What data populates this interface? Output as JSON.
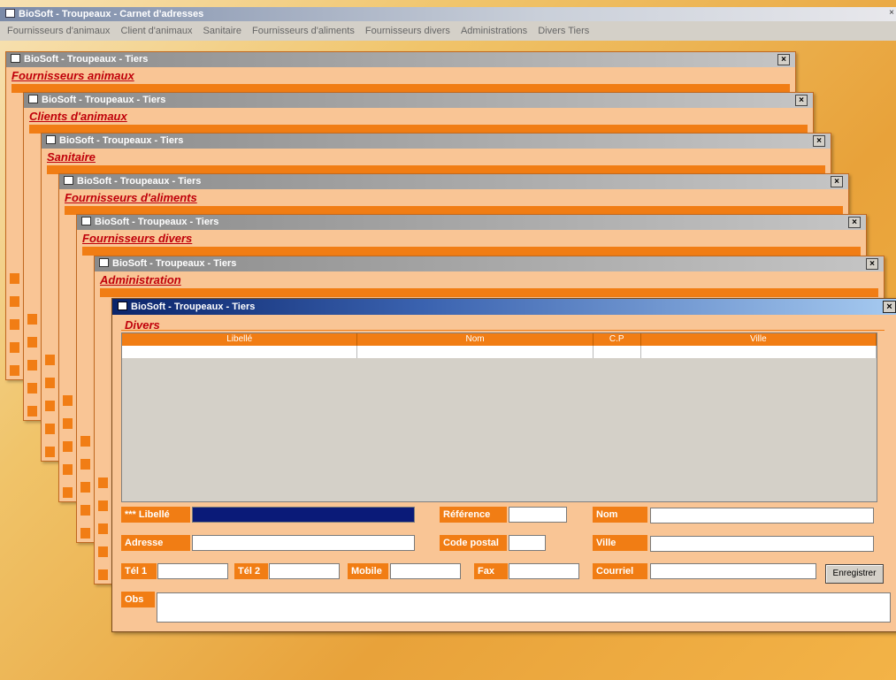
{
  "app": {
    "title": "BioSoft - Troupeaux - Carnet d'adresses",
    "menu": [
      "Fournisseurs d'animaux",
      "Client d'animaux",
      "Sanitaire",
      "Fournisseurs d'aliments",
      "Fournisseurs divers",
      "Administrations",
      "Divers Tiers"
    ]
  },
  "windows": [
    {
      "title": "BioSoft - Troupeaux - Tiers",
      "category": "Fournisseurs animaux"
    },
    {
      "title": "BioSoft - Troupeaux - Tiers",
      "category": "Clients d'animaux"
    },
    {
      "title": "BioSoft - Troupeaux - Tiers",
      "category": "Sanitaire"
    },
    {
      "title": "BioSoft - Troupeaux - Tiers",
      "category": "Fournisseurs d'aliments"
    },
    {
      "title": "BioSoft - Troupeaux - Tiers",
      "category": "Fournisseurs divers"
    },
    {
      "title": "BioSoft - Troupeaux - Tiers",
      "category": "Administration"
    }
  ],
  "front": {
    "title": "BioSoft - Troupeaux - Tiers",
    "category": "Divers",
    "columns": [
      "Libellé",
      "Nom",
      "C.P",
      "Ville"
    ],
    "labels": {
      "libelle": "*** Libellé",
      "reference": "Référence",
      "nom": "Nom",
      "adresse": "Adresse",
      "code_postal": "Code postal",
      "ville": "Ville",
      "tel1": "Tél 1",
      "tel2": "Tél 2",
      "mobile": "Mobile",
      "fax": "Fax",
      "courriel": "Courriel",
      "obs": "Obs"
    },
    "save_button": "Enregistrer"
  }
}
